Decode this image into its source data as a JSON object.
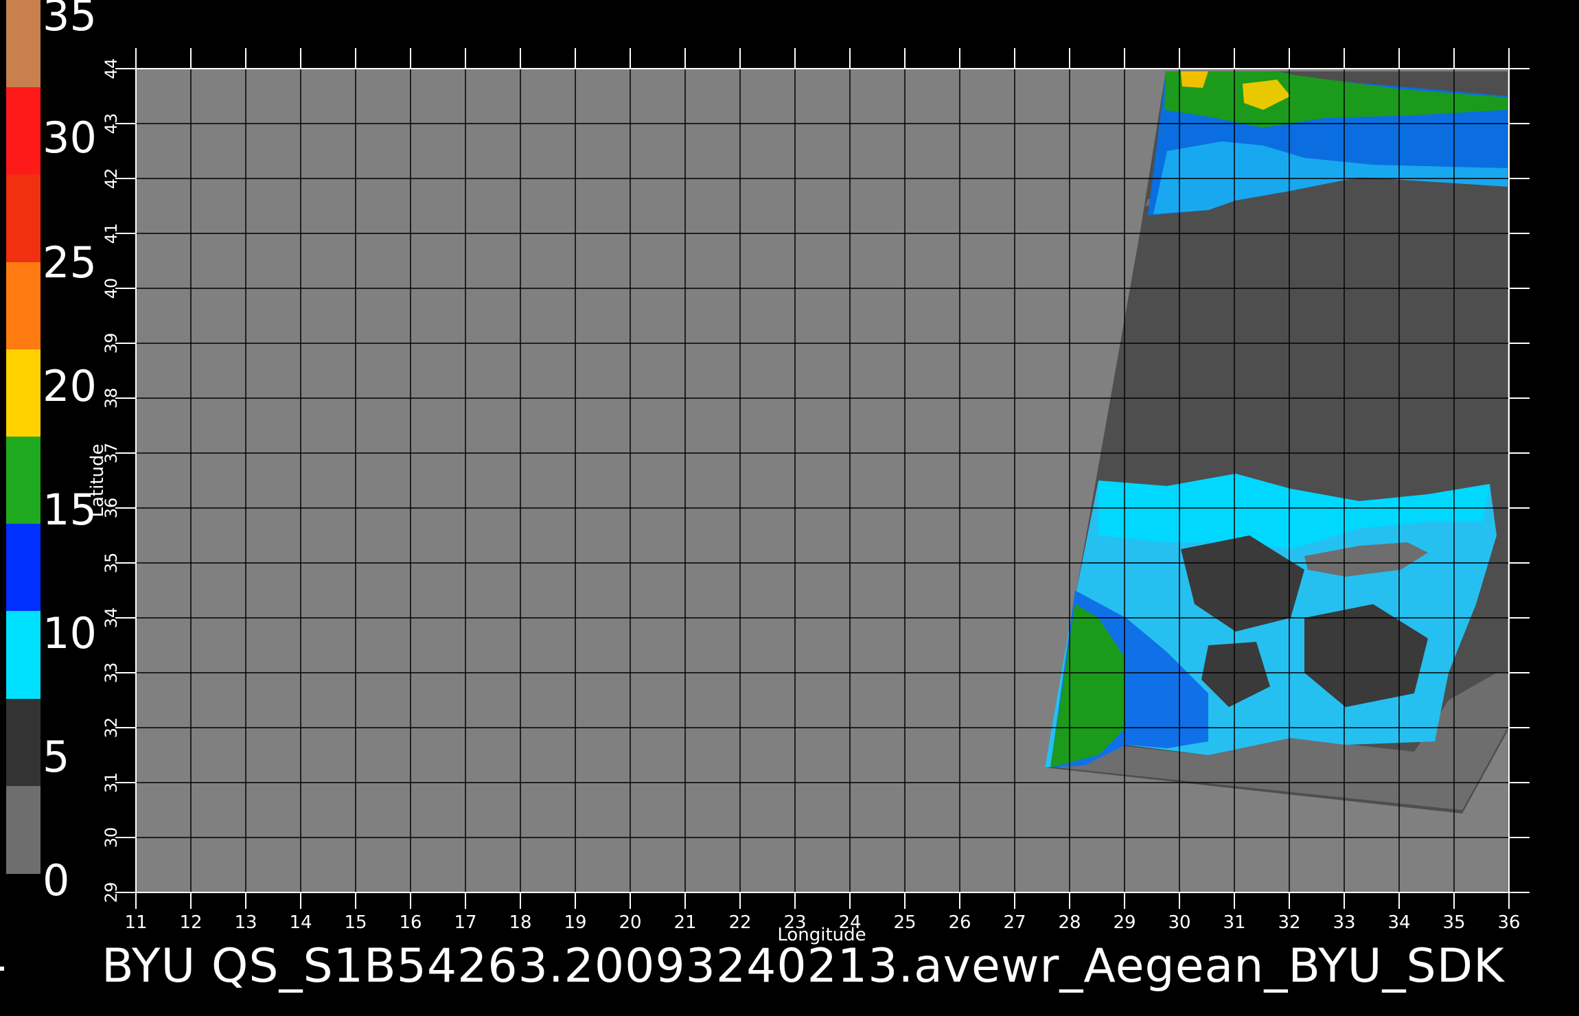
{
  "colorbar": {
    "labels": [
      "35",
      "30",
      "25",
      "20",
      "15",
      "10",
      "5",
      "0"
    ],
    "bands": [
      "#c8804e",
      "#ff1a1a",
      "#f03010",
      "#ff7a10",
      "#ffd200",
      "#1faa1f",
      "#0030ff",
      "#00e0ff",
      "#333333",
      "#6e6e6e"
    ]
  },
  "axes": {
    "xlabel": "Longitude",
    "ylabel": "Latitude",
    "x_ticks": [
      "11",
      "12",
      "13",
      "14",
      "15",
      "16",
      "17",
      "18",
      "19",
      "20",
      "21",
      "22",
      "23",
      "24",
      "25",
      "26",
      "27",
      "28",
      "29",
      "30",
      "31",
      "32",
      "33",
      "34",
      "35",
      "36"
    ],
    "y_ticks": [
      "44",
      "43",
      "42",
      "41",
      "40",
      "39",
      "38",
      "37",
      "36",
      "35",
      "34",
      "33",
      "32",
      "31",
      "30",
      "29"
    ]
  },
  "map": {
    "lon_range": [
      11,
      36
    ],
    "lat_range": [
      29,
      44
    ],
    "background_color": "#808080",
    "swath_land_color": "#4e4e4e"
  },
  "caption": "BYU  QS_S1B54263.20093240213.avewr_Aegean_BYU_SDK"
}
